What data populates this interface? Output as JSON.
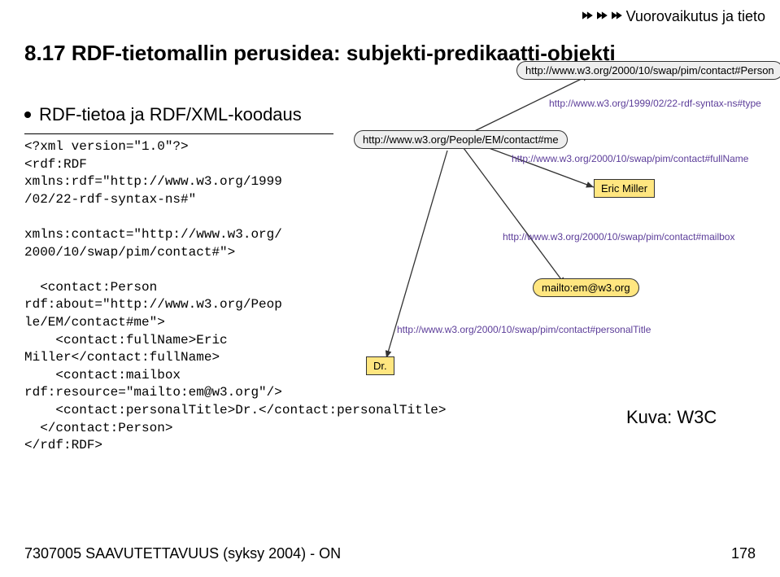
{
  "breadcrumb": "Vuorovaikutus ja tieto",
  "heading": "8.17 RDF-tietomallin perusidea: subjekti-predikaatti-objekti",
  "subheading": "RDF-tietoa ja RDF/XML-koodaus",
  "code": "<?xml version=\"1.0\"?>\n<rdf:RDF\nxmlns:rdf=\"http://www.w3.org/1999\n/02/22-rdf-syntax-ns#\"\n\nxmlns:contact=\"http://www.w3.org/\n2000/10/swap/pim/contact#\">\n\n  <contact:Person\nrdf:about=\"http://www.w3.org/Peop\nle/EM/contact#me\">\n    <contact:fullName>Eric\nMiller</contact:fullName>\n    <contact:mailbox\nrdf:resource=\"mailto:em@w3.org\"/>\n    <contact:personalTitle>Dr.</contact:personalTitle>\n  </contact:Person>\n</rdf:RDF>",
  "diagram": {
    "root_node": "http://www.w3.org/People/EM/contact#me",
    "type_node": "http://www.w3.org/2000/10/swap/pim/contact#Person",
    "name_rect": "Eric Miller",
    "title_rect": "Dr.",
    "mail_node": "mailto:em@w3.org",
    "edge_type": "http://www.w3.org/1999/02/22-rdf-syntax-ns#type",
    "edge_fullname": "http://www.w3.org/2000/10/swap/pim/contact#fullName",
    "edge_mailbox": "http://www.w3.org/2000/10/swap/pim/contact#mailbox",
    "edge_personaltitle": "http://www.w3.org/2000/10/swap/pim/contact#personalTitle"
  },
  "source_label": "Kuva: W3C",
  "footer_left": "7307005 SAAVUTETTAVUUS (syksy 2004) - ON",
  "footer_right": "178"
}
